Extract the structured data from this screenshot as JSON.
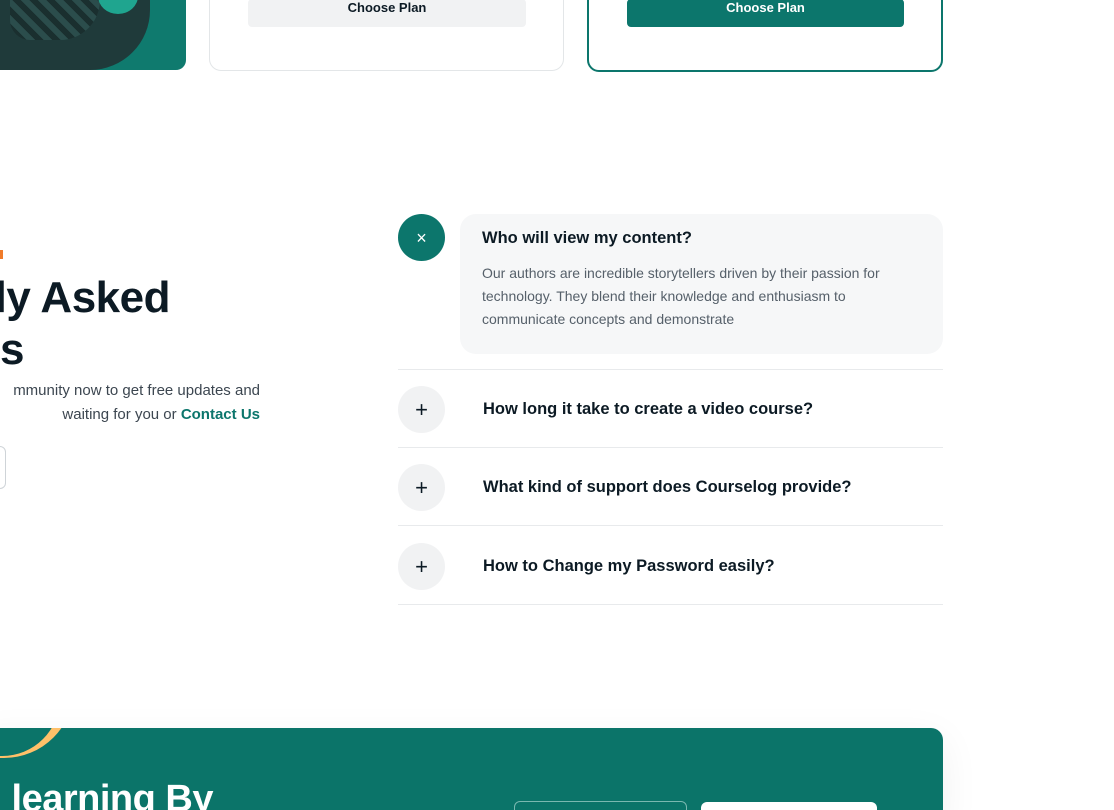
{
  "pricing": {
    "mid_card": {
      "button_label": "Choose Plan"
    },
    "featured_card": {
      "button_label": "Choose Plan"
    }
  },
  "faq_intro": {
    "heading_line1": "ly Asked",
    "heading_line2": "s",
    "subtext_line1": "mmunity now to get free updates and",
    "subtext_line2": "waiting for you or",
    "contact_link": "Contact Us"
  },
  "faq": {
    "open_item": {
      "question": "Who will view my content?",
      "answer": "Our authors are incredible storytellers driven by their passion for technology. They blend their knowledge and enthusiasm to communicate concepts and demonstrate",
      "icon": "×"
    },
    "items": [
      {
        "question": "How long it take to create a video course?",
        "icon": "+"
      },
      {
        "question": "What kind of support does Courselog provide?",
        "icon": "+"
      },
      {
        "question": "How to Change my Password easily?",
        "icon": "+"
      }
    ]
  },
  "cta": {
    "title": "learning By"
  },
  "colors": {
    "brand_teal": "#0c766c",
    "accent_orange": "#f07b2a",
    "cta_blob": "#ffc069"
  }
}
